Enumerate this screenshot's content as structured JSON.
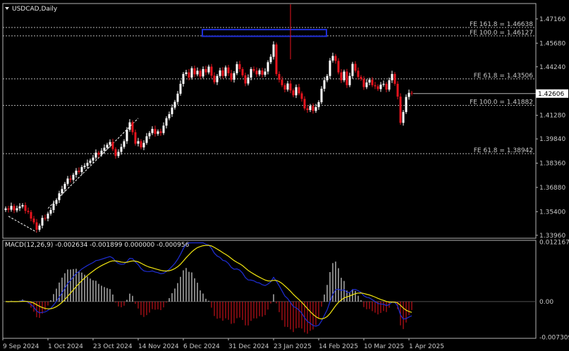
{
  "chart_data": [
    {
      "type": "candlestick",
      "symbol_label": "USDCAD,Daily",
      "current_price_label": "1.42606",
      "current_price": 1.42606,
      "ylim": [
        1.3378,
        1.481
      ],
      "y_ticks": [
        {
          "label": "1.47160",
          "value": 1.4716
        },
        {
          "label": "1.45680",
          "value": 1.4568
        },
        {
          "label": "1.44240",
          "value": 1.4424
        },
        {
          "label": "1.41280",
          "value": 1.4128
        },
        {
          "label": "1.39840",
          "value": 1.3984
        },
        {
          "label": "1.38360",
          "value": 1.3836
        },
        {
          "label": "1.36880",
          "value": 1.3688
        },
        {
          "label": "1.35400",
          "value": 1.354
        },
        {
          "label": "1.33960",
          "value": 1.3396
        }
      ],
      "x_ticks": [
        {
          "label": "9 Sep 2024",
          "index": 0
        },
        {
          "label": "1 Oct 2024",
          "index": 16
        },
        {
          "label": "23 Oct 2024",
          "index": 32
        },
        {
          "label": "14 Nov 2024",
          "index": 48
        },
        {
          "label": "6 Dec 2024",
          "index": 64
        },
        {
          "label": "31 Dec 2024",
          "index": 80
        },
        {
          "label": "23 Jan 2025",
          "index": 96
        },
        {
          "label": "14 Feb 2025",
          "index": 112
        },
        {
          "label": "10 Mar 2025",
          "index": 128
        },
        {
          "label": "1 Apr 2025",
          "index": 144
        }
      ],
      "fib_levels": [
        {
          "label": "FE 161.8 = 1.46638",
          "value": 1.46638
        },
        {
          "label": "FE 100.0 = 1.46127",
          "value": 1.46127
        },
        {
          "label": "FE 61.8 = 1.43506",
          "value": 1.43506
        },
        {
          "label": "FE 100.0 = 1.41882",
          "value": 1.41882
        },
        {
          "label": "FE 61.8 = 1.38942",
          "value": 1.38942
        }
      ],
      "highlight_zone": {
        "x_start_index": 70,
        "x_end_index": 113,
        "y_top": 1.4651,
        "y_bottom": 1.461
      },
      "trend_line": [
        {
          "index": 1,
          "value": 1.3512
        },
        {
          "index": 11,
          "value": 1.3415
        },
        {
          "index": 47,
          "value": 1.411
        },
        {
          "index": 15,
          "value": 1.356
        }
      ],
      "colors": {
        "up": "#ffffff",
        "down": "#e8141e",
        "zone": "#1f2ed6",
        "macd_line": "#1f2ed6",
        "signal_line": "#f2e60f",
        "hist_up": "#ffffff",
        "hist_down": "#e8141e"
      },
      "closes": [
        1.356,
        1.3552,
        1.3575,
        1.3548,
        1.3561,
        1.3572,
        1.358,
        1.3545,
        1.3538,
        1.3498,
        1.3475,
        1.343,
        1.3455,
        1.3502,
        1.3498,
        1.3528,
        1.355,
        1.3588,
        1.361,
        1.3652,
        1.3678,
        1.371,
        1.3742,
        1.3735,
        1.3765,
        1.379,
        1.3782,
        1.3812,
        1.382,
        1.3838,
        1.3852,
        1.387,
        1.39,
        1.3888,
        1.3912,
        1.393,
        1.3948,
        1.3965,
        1.3922,
        1.388,
        1.3905,
        1.3935,
        1.397,
        1.404,
        1.4085,
        1.4025,
        1.3955,
        1.397,
        1.3932,
        1.396,
        1.4,
        1.402,
        1.4045,
        1.4015,
        1.403,
        1.402,
        1.4065,
        1.411,
        1.4135,
        1.4175,
        1.421,
        1.426,
        1.432,
        1.438,
        1.439,
        1.4358,
        1.4415,
        1.4378,
        1.44,
        1.4365,
        1.441,
        1.439,
        1.4425,
        1.437,
        1.433,
        1.4368,
        1.4402,
        1.4368,
        1.442,
        1.4385,
        1.4345,
        1.4385,
        1.444,
        1.441,
        1.4372,
        1.4322,
        1.4358,
        1.441,
        1.44,
        1.4378,
        1.4402,
        1.4375,
        1.4395,
        1.4452,
        1.4485,
        1.456,
        1.438,
        1.4345,
        1.4312,
        1.4285,
        1.4322,
        1.428,
        1.425,
        1.43,
        1.4262,
        1.4228,
        1.417,
        1.416,
        1.4185,
        1.4155,
        1.4178,
        1.4208,
        1.429,
        1.4342,
        1.4368,
        1.4462,
        1.449,
        1.446,
        1.439,
        1.4342,
        1.4395,
        1.4312,
        1.4368,
        1.4442,
        1.44,
        1.4362,
        1.435,
        1.43,
        1.4328,
        1.4345,
        1.4312,
        1.4305,
        1.4288,
        1.4315,
        1.432,
        1.4285,
        1.4342,
        1.438,
        1.432,
        1.4242,
        1.4082,
        1.4148,
        1.424,
        1.4265,
        1.4261
      ],
      "macd_label": "MACD(12,26,9) -0.002634 -0.001899 0.000000 -0.000956",
      "macd_ylim": [
        -0.0075,
        0.0125
      ],
      "macd_ticks": [
        {
          "label": "0.012167",
          "value": 0.012167
        },
        {
          "label": "0.00",
          "value": 0.0
        },
        {
          "label": "-0.007309",
          "value": -0.007309
        }
      ]
    }
  ]
}
